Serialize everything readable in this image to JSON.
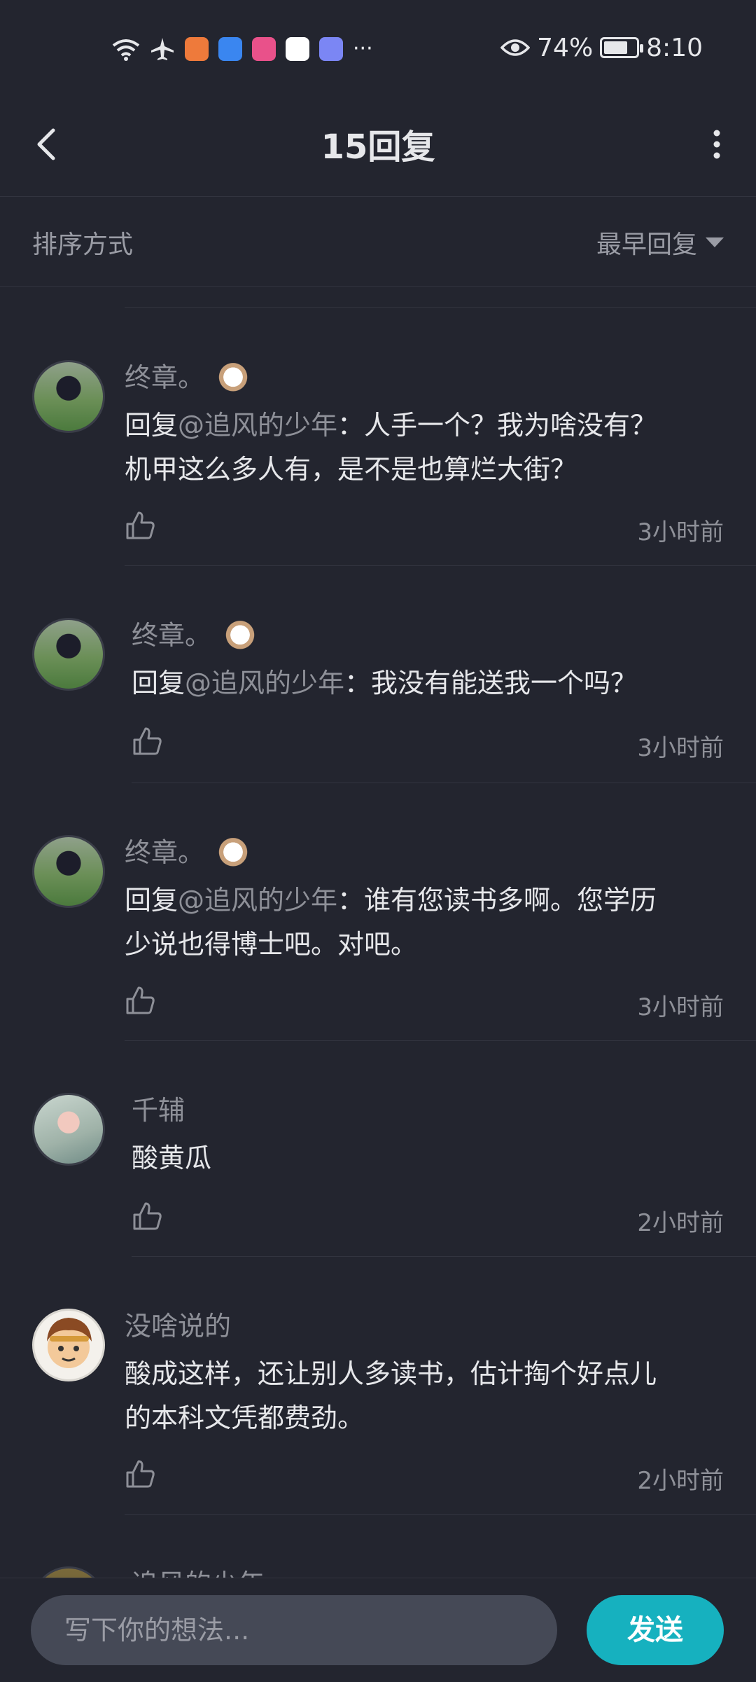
{
  "status_bar": {
    "battery_percent": "74%",
    "battery_level": 0.74,
    "time": "8:10",
    "icons": [
      "wifi-icon",
      "airplane-icon",
      "health-app-icon",
      "cloud-app-icon",
      "bilibili-app-icon",
      "browser-app-icon",
      "music-app-icon",
      "more-dots-icon",
      "eye-icon",
      "battery-icon"
    ]
  },
  "header": {
    "title": "15回复"
  },
  "sort": {
    "label": "排序方式",
    "value": "最早回复"
  },
  "comments": [
    {
      "name": "终章。",
      "has_badge": true,
      "reply_prefix": "回复",
      "mention": "@追风的少年",
      "body_line1": "：人手一个？我为啥没有？",
      "body_line2": "机甲这么多人有，是不是也算烂大街？",
      "time": "3小时前"
    },
    {
      "name": "终章。",
      "has_badge": true,
      "reply_prefix": "回复",
      "mention": "@追风的少年",
      "body_line1": "：我没有能送我一个吗？",
      "body_line2": "",
      "time": "3小时前"
    },
    {
      "name": "终章。",
      "has_badge": true,
      "reply_prefix": "回复",
      "mention": "@追风的少年",
      "body_line1": "：谁有您读书多啊。您学历",
      "body_line2": "少说也得博士吧。对吧。",
      "time": "3小时前"
    },
    {
      "name": "千辅",
      "has_badge": false,
      "reply_prefix": "",
      "mention": "",
      "body_line1": "酸黄瓜",
      "body_line2": "",
      "time": "2小时前"
    },
    {
      "name": "没啥说的",
      "has_badge": false,
      "reply_prefix": "",
      "mention": "",
      "body_line1": "酸成这样，还让别人多读书，估计掏个好点儿",
      "body_line2": "的本科文凭都费劲。",
      "time": "2小时前"
    },
    {
      "name": "追风的少年",
      "has_badge": false,
      "partial": true
    }
  ],
  "input": {
    "placeholder": "写下你的想法..."
  },
  "send_label": "发送",
  "colors": {
    "background": "#23252f",
    "accent": "#16b1bf",
    "muted_text": "#8e9098",
    "input_bg": "#454956"
  }
}
